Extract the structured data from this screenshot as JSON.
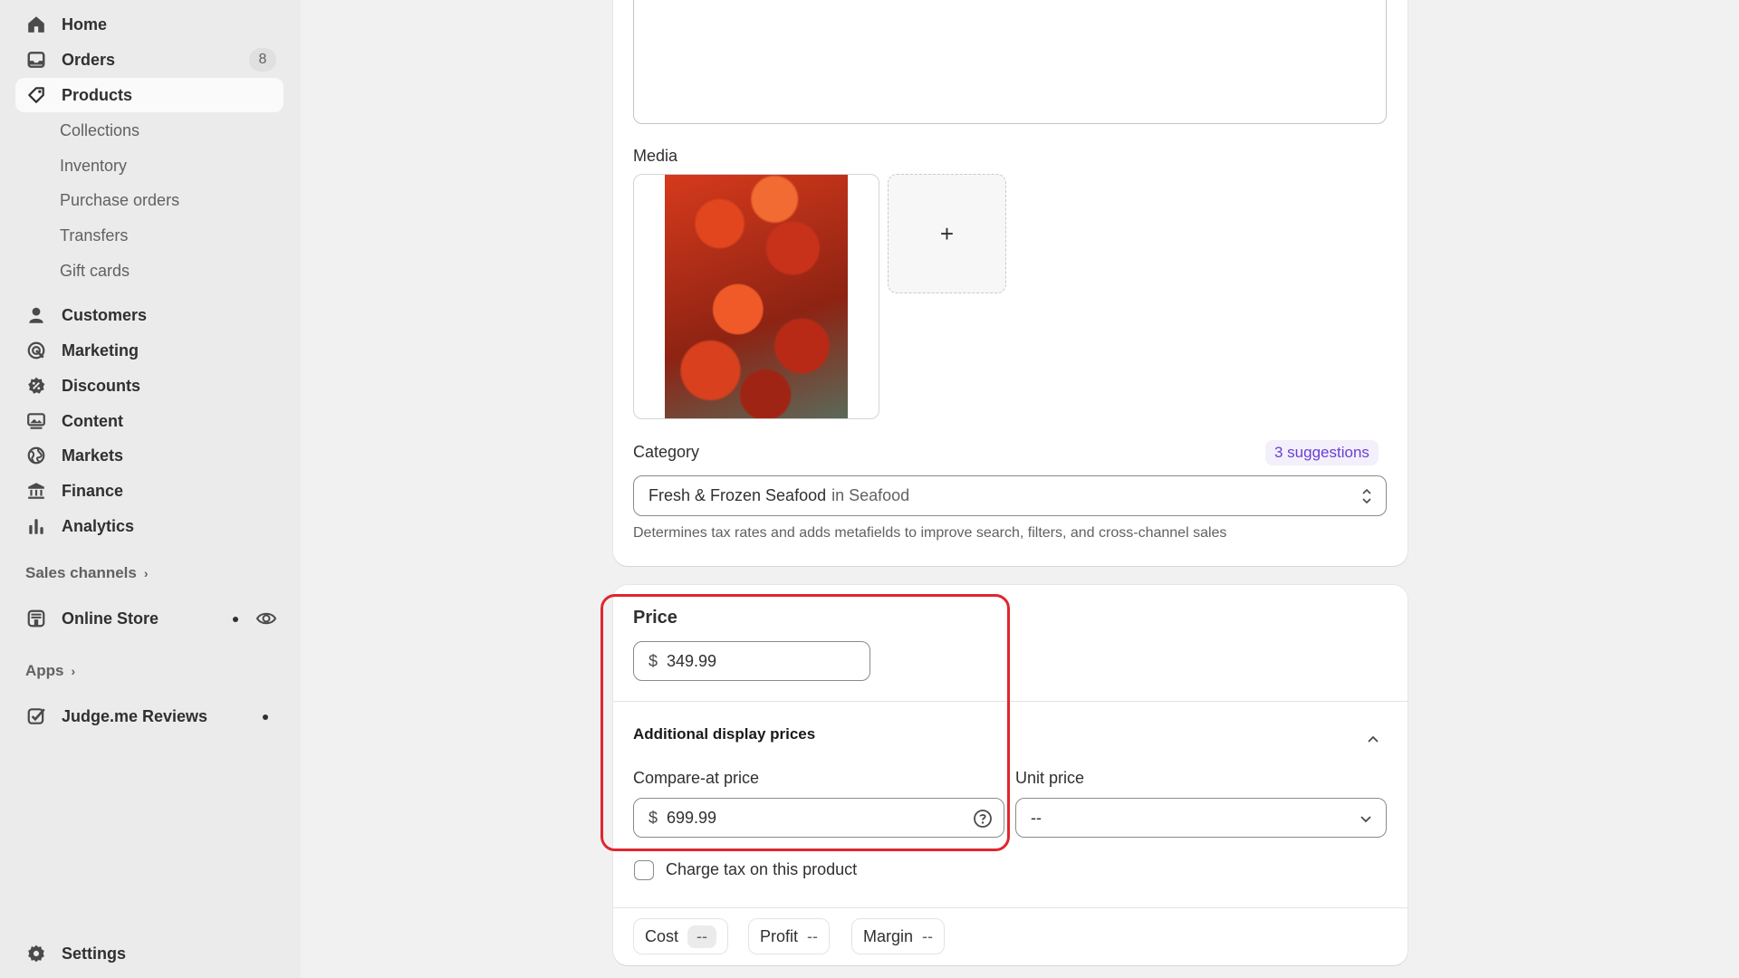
{
  "sidebar": {
    "items": [
      {
        "label": "Home",
        "icon": "home-icon"
      },
      {
        "label": "Orders",
        "icon": "inbox-icon",
        "badge": "8"
      },
      {
        "label": "Products",
        "icon": "tag-icon",
        "active": true
      },
      {
        "label": "Customers",
        "icon": "person-icon"
      },
      {
        "label": "Marketing",
        "icon": "target-icon"
      },
      {
        "label": "Discounts",
        "icon": "discount-icon"
      },
      {
        "label": "Content",
        "icon": "content-icon"
      },
      {
        "label": "Markets",
        "icon": "globe-icon"
      },
      {
        "label": "Finance",
        "icon": "bank-icon"
      },
      {
        "label": "Analytics",
        "icon": "bar-chart-icon"
      }
    ],
    "product_subitems": [
      "Collections",
      "Inventory",
      "Purchase orders",
      "Transfers",
      "Gift cards"
    ],
    "sales_channels_label": "Sales channels",
    "online_store_label": "Online Store",
    "apps_label": "Apps",
    "judgeme_label": "Judge.me Reviews",
    "settings_label": "Settings"
  },
  "media": {
    "label": "Media",
    "add_symbol": "+"
  },
  "category": {
    "label": "Category",
    "suggestions": "3 suggestions",
    "value_main": "Fresh & Frozen Seafood",
    "value_sub": "in Seafood",
    "help": "Determines tax rates and adds metafields to improve search, filters, and cross-channel sales"
  },
  "pricing": {
    "price_label": "Price",
    "currency": "$",
    "price_value": "349.99",
    "additional_label": "Additional display prices",
    "compare_label": "Compare-at price",
    "compare_value": "699.99",
    "unit_label": "Unit price",
    "unit_value": "--",
    "tax_label": "Charge tax on this product",
    "tax_checked": false,
    "cost_label": "Cost",
    "cost_value": "--",
    "profit_label": "Profit",
    "profit_value": "--",
    "margin_label": "Margin",
    "margin_value": "--"
  },
  "colors": {
    "highlight": "#e0262e",
    "suggestion": "#6a3fd6"
  }
}
